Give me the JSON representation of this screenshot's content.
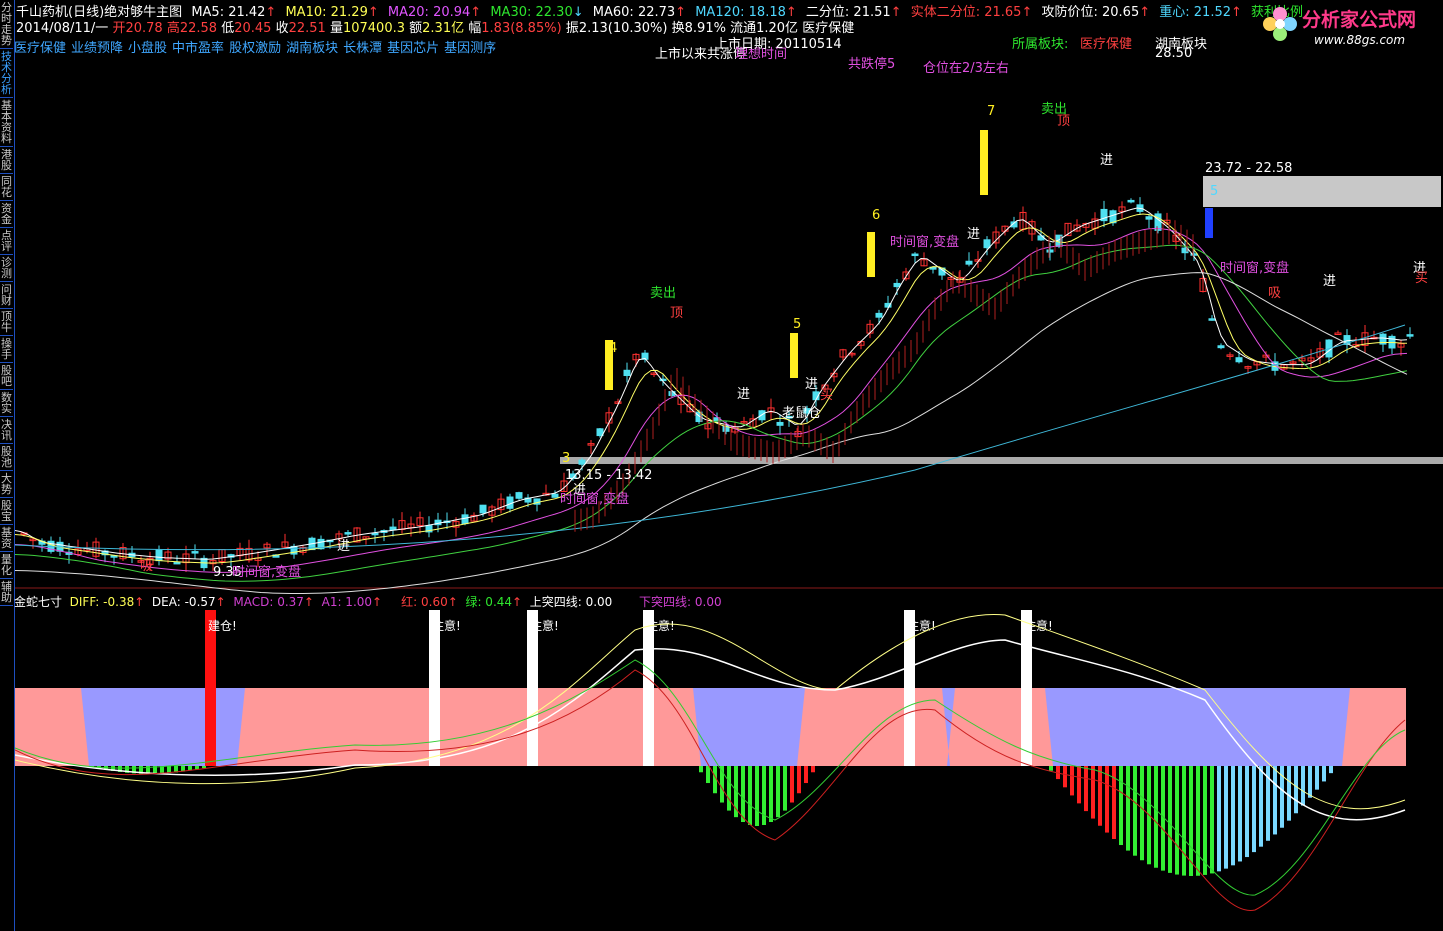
{
  "left_tabs": [
    "分时走势",
    "技术分析",
    "基本资料",
    "港股",
    "同花",
    "资金",
    "点评",
    "诊测",
    "问财",
    "顶牛",
    "操手",
    "股吧",
    "数实",
    "决讯",
    "股池",
    "大势",
    "股宝",
    "基资",
    "量化",
    "辅助"
  ],
  "header": {
    "stock": "千山药机(日线)",
    "template": "绝对够牛主图",
    "ma5": "MA5: 21.42",
    "ma10": "MA10: 21.29",
    "ma20": "MA20: 20.94",
    "ma30": "MA30: 22.30",
    "ma60": "MA60: 22.73",
    "ma120": "MA120: 18.18",
    "erfen": "二分位: 21.51",
    "shiti": "实体二分位: 21.65",
    "gongfang": "攻防价位: 20.65",
    "zhongxin": "重心: 21.52",
    "huoli": "获利比例",
    "up_arrow": "↑",
    "down_arrow": "↓"
  },
  "ohlc": {
    "date": "2014/08/11/一",
    "open_label": "开",
    "open": "20.78",
    "high_label": "高",
    "high": "22.58",
    "low_label": "低",
    "low": "20.45",
    "close_label": "收",
    "close": "22.51",
    "vol_label": "量",
    "vol": "107400.3",
    "amt_label": "额",
    "amt": "2.31亿",
    "chg_label": "幅",
    "chg": "1.83(8.85%)",
    "amp_label": "振",
    "amp": "2.13(10.30%)",
    "turn_label": "换",
    "turn": "8.91%",
    "float_label": "流通",
    "float": "1.20亿",
    "sector": "医疗保健"
  },
  "concepts": [
    "医疗保健",
    "业绩预降",
    "小盘股",
    "中市盈率",
    "股权激励",
    "湖南板块",
    "长株潭",
    "基因芯片",
    "基因测序"
  ],
  "info": {
    "listing": "上市日期: 20110514",
    "sector_label": "所属板块:",
    "sector1": "医疗保健",
    "sector2": "湖南板块",
    "stats": "上市以来共涨停",
    "stats2": "理想时间",
    "stats3": "共跌停5",
    "position": "仓位在2/3左右"
  },
  "annotations": {
    "high_price": "28.50",
    "range1": "23.72 - 22.58",
    "range2": "13.15 - 13.42",
    "low_price": "9.35",
    "sell": "卖出",
    "top": "顶",
    "enter": "进",
    "buy": "买",
    "absorb": "吸",
    "mouse": "老鼠仓",
    "window": "时间窗,变盘",
    "wave3": "3",
    "wave4": "4",
    "wave5": "5",
    "wave6": "6",
    "wave7": "7",
    "wave5b": "5"
  },
  "sub": {
    "name": "金蛇七寸",
    "diff": "DIFF: -0.38",
    "dea": "DEA: -0.57",
    "macd": "MACD: 0.37",
    "a1": "A1: 1.00",
    "red": "红: 0.60",
    "green": "绿: 0.44",
    "up4": "上突四线: 0.00",
    "down4": "下突四线: 0.00",
    "build": "建仓!",
    "attention": "注意!"
  },
  "logo": {
    "text": "分析家公式网",
    "url": "www.88gs.com"
  },
  "colors": {
    "up": "#ff3030",
    "down": "#4fe0f0",
    "yellow": "#ffee22",
    "pink": "#ff9999",
    "lavender": "#9999ff",
    "bg": "#000000"
  }
}
